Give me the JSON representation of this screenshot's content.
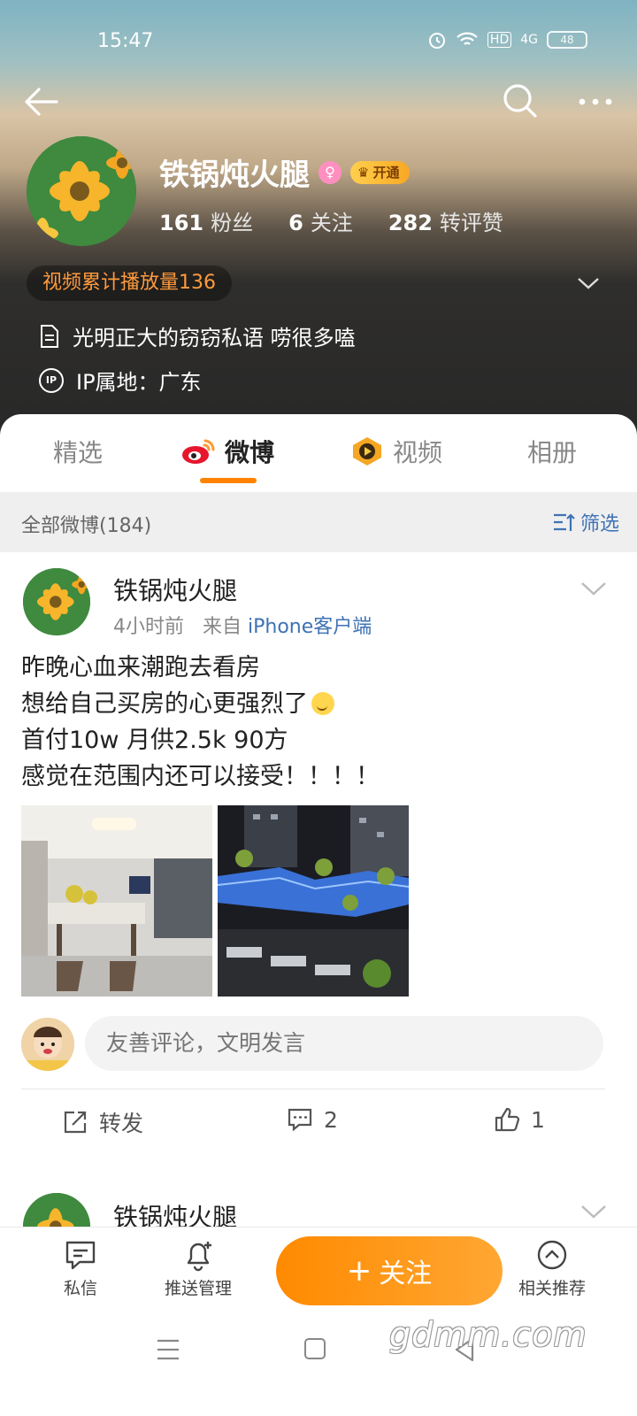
{
  "status": {
    "time": "15:47",
    "net_label": "HD",
    "signal_label": "4G",
    "battery": "48"
  },
  "profile": {
    "name": "铁锅炖火腿",
    "vip_label": "开通",
    "stats": [
      {
        "num": "161",
        "label": "粉丝"
      },
      {
        "num": "6",
        "label": "关注"
      },
      {
        "num": "282",
        "label": "转评赞"
      }
    ],
    "play_count": "视频累计播放量136",
    "bio": "光明正大的窃窃私语 唠很多嗑",
    "ip_icon": "IP",
    "ip": "IP属地：广东"
  },
  "tabs": [
    {
      "label": "精选"
    },
    {
      "label": "微博"
    },
    {
      "label": "视频"
    },
    {
      "label": "相册"
    }
  ],
  "filter": {
    "count_label": "全部微博(184)",
    "filter_label": "筛选"
  },
  "post": {
    "author": "铁锅炖火腿",
    "time": "4小时前",
    "from_prefix": "来自",
    "source": "iPhone客户端",
    "lines": [
      "昨晚心血来潮跑去看房",
      "想给自己买房的心更强烈了",
      "首付10w 月供2.5k 90方",
      "感觉在范围内还可以接受！！！！"
    ],
    "comment_placeholder": "友善评论，文明发言",
    "repost_label": "转发",
    "comment_count": "2",
    "like_count": "1"
  },
  "post2": {
    "author": "铁锅炖火腿"
  },
  "bottom": {
    "dm_label": "私信",
    "push_label": "推送管理",
    "follow_label": "关注",
    "follow_plus": "+",
    "related_label": "相关推荐"
  },
  "watermark": "gdmm.com",
  "colors": {
    "accent": "#ff8200",
    "link": "#3e72b5",
    "play_count": "#ff9a3d"
  }
}
